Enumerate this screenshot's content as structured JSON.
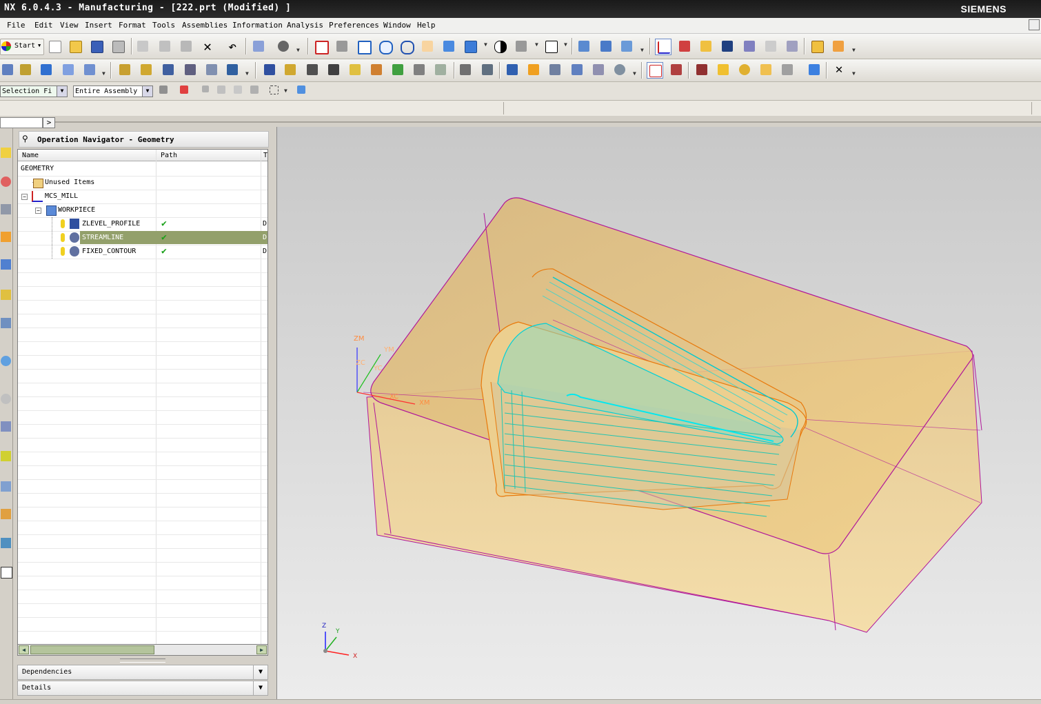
{
  "app": {
    "title": "NX 6.0.4.3 - Manufacturing - [222.prt (Modified) ]",
    "brand": "SIEMENS"
  },
  "menu": [
    "File",
    "Edit",
    "View",
    "Insert",
    "Format",
    "Tools",
    "Assemblies",
    "Information",
    "Analysis",
    "Preferences",
    "Window",
    "Help"
  ],
  "toolbar": {
    "start_label": "Start"
  },
  "selection_bar": {
    "filter": "Selection Fi",
    "scope": "Entire Assembly"
  },
  "navigator": {
    "title": "Operation Navigator - Geometry",
    "columns": {
      "name": "Name",
      "path": "Path",
      "extra": "T"
    },
    "rows": [
      {
        "label": "GEOMETRY",
        "path": "",
        "extra": ""
      },
      {
        "label": "Unused Items",
        "path": "",
        "extra": ""
      },
      {
        "label": "MCS_MILL",
        "path": "",
        "extra": ""
      },
      {
        "label": "WORKPIECE",
        "path": "",
        "extra": ""
      },
      {
        "label": "ZLEVEL_PROFILE",
        "path": "✔",
        "extra": "D"
      },
      {
        "label": "STREAMLINE",
        "path": "✔",
        "extra": "D"
      },
      {
        "label": "FIXED_CONTOUR",
        "path": "✔",
        "extra": "D"
      }
    ],
    "dependencies_label": "Dependencies",
    "details_label": "Details"
  },
  "viewport": {
    "work_axes": {
      "zm": "ZM",
      "ym": "YM",
      "zc": "ZC",
      "yc": "YC",
      "xc": "XC",
      "xm": "XM"
    },
    "triad": {
      "z": "Z",
      "y": "Y",
      "x": "X"
    }
  }
}
